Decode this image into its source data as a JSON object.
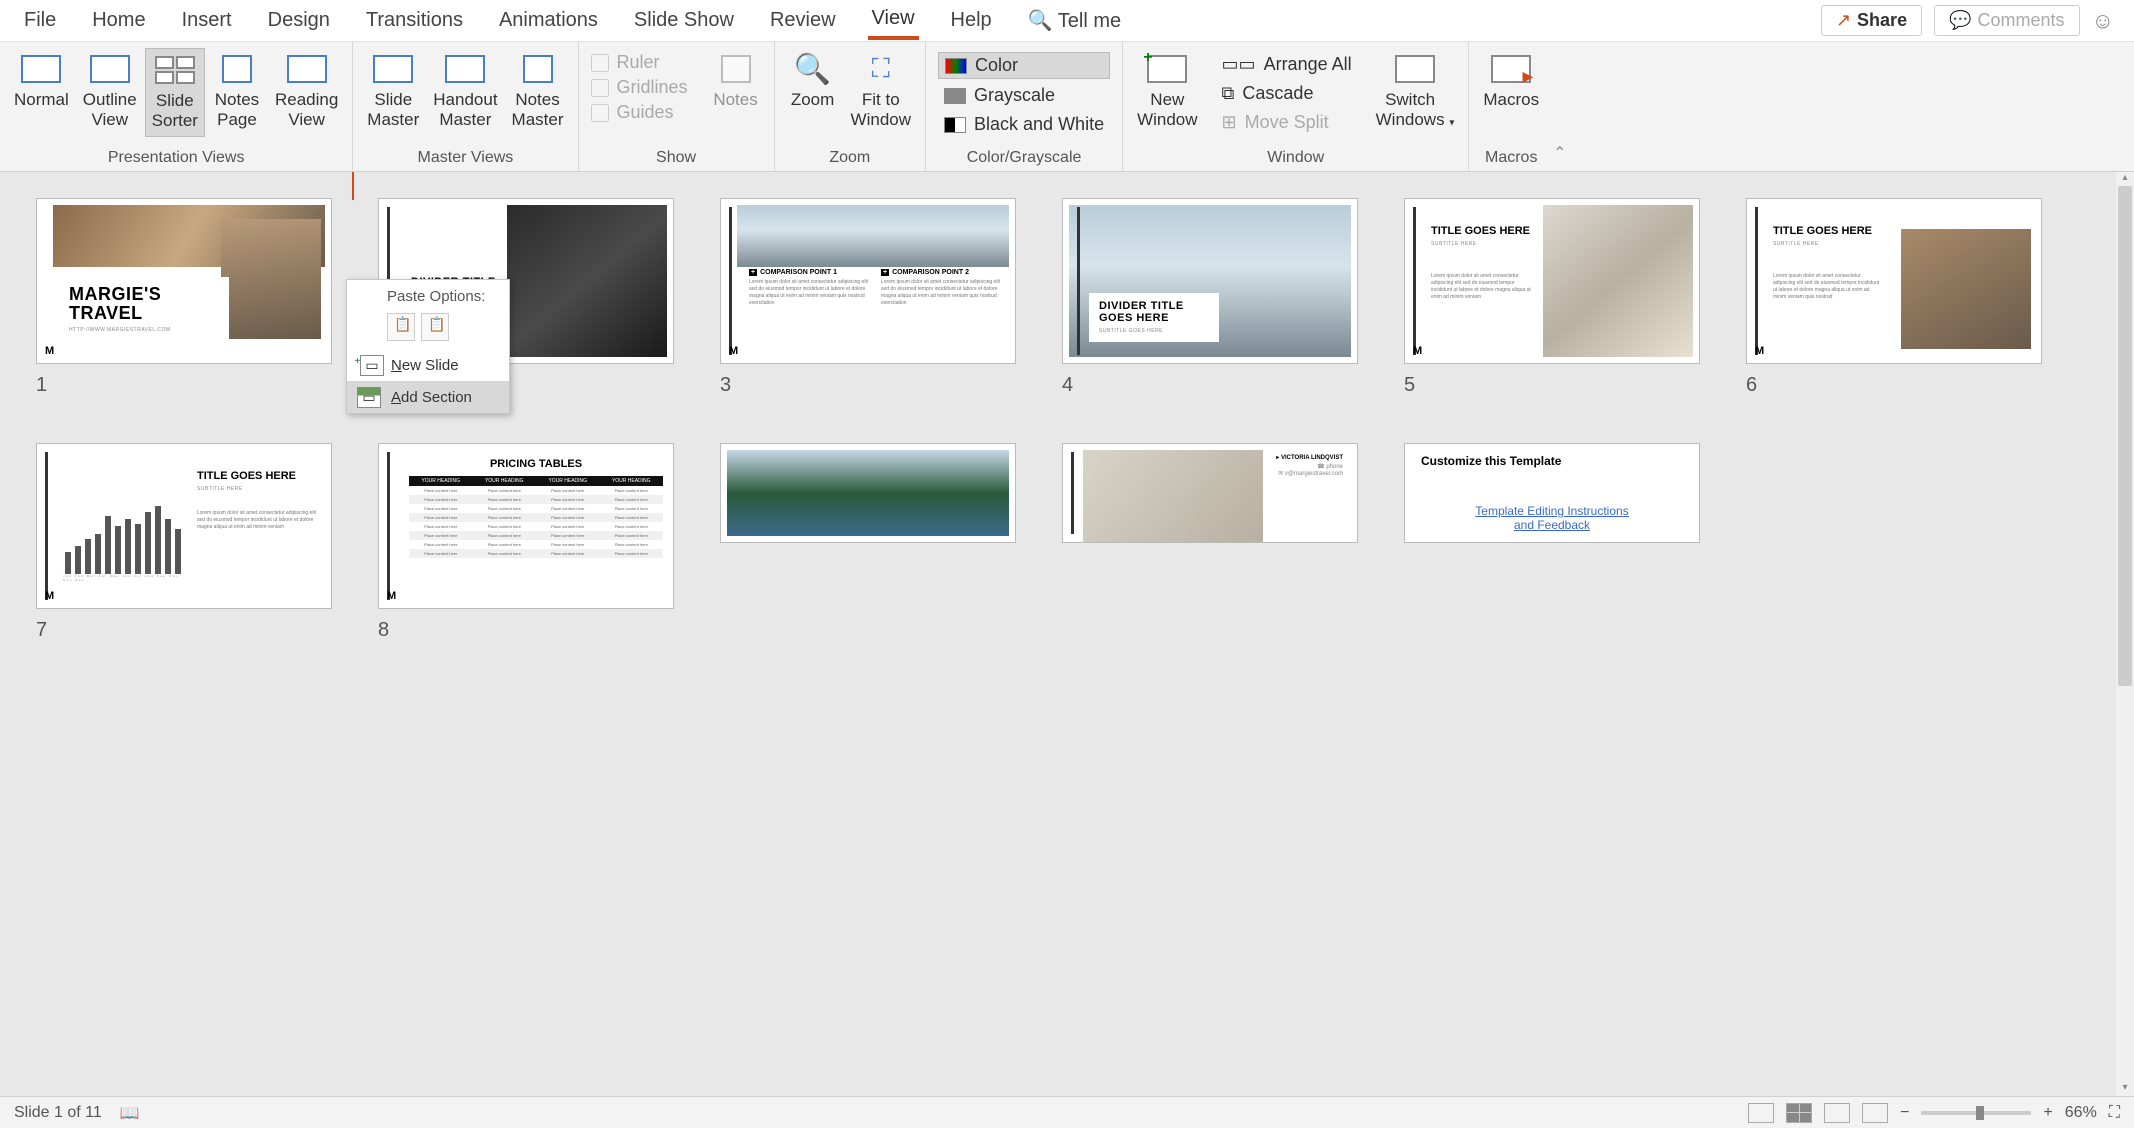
{
  "menubar": {
    "items": [
      "File",
      "Home",
      "Insert",
      "Design",
      "Transitions",
      "Animations",
      "Slide Show",
      "Review",
      "View",
      "Help"
    ],
    "active_index": 8,
    "tellme": "Tell me",
    "share": "Share",
    "comments": "Comments"
  },
  "ribbon": {
    "groups": {
      "presentation_views": {
        "label": "Presentation Views",
        "buttons": [
          {
            "label": "Normal"
          },
          {
            "label": "Outline\nView"
          },
          {
            "label": "Slide\nSorter",
            "active": true
          },
          {
            "label": "Notes\nPage"
          },
          {
            "label": "Reading\nView"
          }
        ]
      },
      "master_views": {
        "label": "Master Views",
        "buttons": [
          {
            "label": "Slide\nMaster"
          },
          {
            "label": "Handout\nMaster"
          },
          {
            "label": "Notes\nMaster"
          }
        ]
      },
      "show": {
        "label": "Show",
        "checks": [
          {
            "label": "Ruler",
            "disabled": true
          },
          {
            "label": "Gridlines",
            "disabled": true
          },
          {
            "label": "Guides",
            "disabled": true
          }
        ],
        "notes_label": "Notes"
      },
      "zoom": {
        "label": "Zoom",
        "buttons": [
          {
            "label": "Zoom"
          },
          {
            "label": "Fit to\nWindow"
          }
        ]
      },
      "color_grayscale": {
        "label": "Color/Grayscale",
        "rows": [
          {
            "label": "Color",
            "active": true,
            "swatch": "gradient"
          },
          {
            "label": "Grayscale",
            "swatch": "#888"
          },
          {
            "label": "Black and White",
            "swatch": "half"
          }
        ]
      },
      "window": {
        "label": "Window",
        "new_window": "New\nWindow",
        "rows": [
          {
            "label": "Arrange All"
          },
          {
            "label": "Cascade"
          },
          {
            "label": "Move Split",
            "disabled": true
          }
        ],
        "switch": "Switch\nWindows"
      },
      "macros": {
        "label": "Macros",
        "button": "Macros"
      }
    }
  },
  "slides": [
    {
      "num": "1",
      "type": "title",
      "title": "MARGIE'S TRAVEL",
      "url": "HTTP://WWW.MARGIESTRAVEL.COM"
    },
    {
      "num": "",
      "type": "divider-suitcase",
      "title": "DIVIDER TITLE"
    },
    {
      "num": "3",
      "type": "comparison",
      "h1": "COMPARISON POINT 1",
      "h2": "COMPARISON POINT 2"
    },
    {
      "num": "4",
      "type": "divider-mountain",
      "title": "DIVIDER TITLE GOES HERE",
      "sub": "SUBTITLE GOES HERE"
    },
    {
      "num": "5",
      "type": "content-desk",
      "title": "TITLE GOES HERE",
      "sub": "SUBTITLE HERE"
    },
    {
      "num": "6",
      "type": "content-photo",
      "title": "TITLE GOES HERE",
      "sub": "SUBTITLE HERE"
    },
    {
      "num": "7",
      "type": "chart",
      "title": "TITLE GOES HERE",
      "sub": "SUBTITLE HERE"
    },
    {
      "num": "8",
      "type": "pricing",
      "title": "PRICING TABLES",
      "col": "YOUR HEADING",
      "cell": "Place content here"
    },
    {
      "num": "",
      "type": "lake"
    },
    {
      "num": "",
      "type": "flatlay",
      "name": "VICTORIA LINDQVIST",
      "email": "v@margiestravel.com"
    },
    {
      "num": "",
      "type": "customize",
      "title": "Customize this Template",
      "link1": "Template Editing Instructions",
      "link2": "and Feedback"
    }
  ],
  "context_menu": {
    "paste_header": "Paste Options:",
    "new_slide": "New Slide",
    "add_section": "Add Section"
  },
  "statusbar": {
    "slide_pos": "Slide 1 of 11",
    "zoom": "66%"
  },
  "chart_data": {
    "type": "bar",
    "categories": [
      "Jan",
      "Feb",
      "Mar",
      "Apr",
      "May",
      "Jun",
      "Jul",
      "Aug",
      "Sep",
      "Oct",
      "Nov",
      "Dec"
    ],
    "values": [
      22,
      28,
      35,
      40,
      58,
      48,
      55,
      50,
      62,
      68,
      55,
      45
    ],
    "ylim": [
      0,
      70
    ]
  }
}
